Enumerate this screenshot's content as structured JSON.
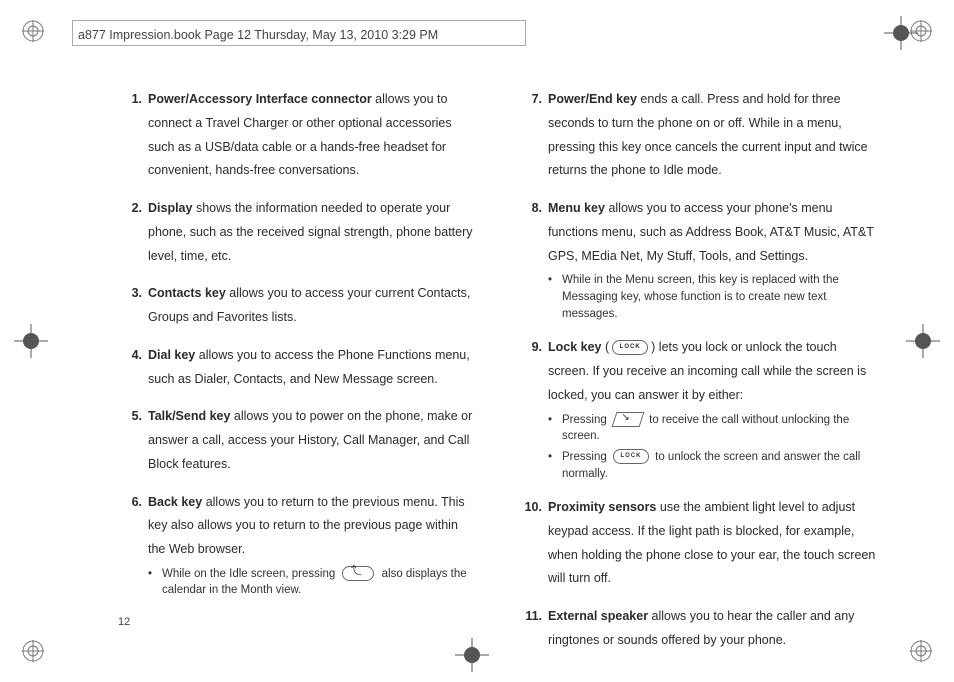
{
  "header": "a877 Impression.book  Page 12  Thursday, May 13, 2010  3:29 PM",
  "page_number": "12",
  "items": [
    {
      "n": "1.",
      "term": "Power/Accessory Interface connector",
      "body": " allows you to connect a Travel Charger or other optional accessories such as a USB/data cable or a hands-free headset for convenient, hands-free conversations."
    },
    {
      "n": "2.",
      "term": "Display",
      "body": " shows the information needed to operate your phone, such as the received signal strength, phone battery level, time, etc."
    },
    {
      "n": "3.",
      "term": "Contacts key",
      "body": " allows you to access your current Contacts, Groups and Favorites lists."
    },
    {
      "n": "4.",
      "term": "Dial key",
      "body": " allows you to access the Phone Functions menu, such as Dialer, Contacts, and New Message screen."
    },
    {
      "n": "5.",
      "term": "Talk/Send key",
      "body": " allows you to power on the phone, make or answer a call, access your History, Call Manager, and Call Block features."
    },
    {
      "n": "6.",
      "term": "Back key",
      "body": " allows you to return to the previous menu. This key also allows you to return to the previous page within the Web browser.",
      "sub": [
        {
          "pre": "While on the Idle screen, pressing ",
          "icon": "back",
          "post": " also displays the calendar in the Month view."
        }
      ]
    },
    {
      "n": "7.",
      "term": "Power/End key",
      "body": " ends a call. Press and hold for three seconds to turn the phone on or off. While in a menu, pressing this key once cancels the current input and twice returns the phone to Idle mode."
    },
    {
      "n": "8.",
      "term": "Menu key",
      "body": " allows you to access your phone's menu functions menu, such as Address Book, AT&T Music, AT&T GPS, MEdia Net, My Stuff, Tools, and Settings.",
      "sub": [
        {
          "pre": "While in the Menu screen, this key is replaced with the Messaging key, whose function is to create new text messages.",
          "icon": "",
          "post": ""
        }
      ]
    },
    {
      "n": "9.",
      "term": "Lock key",
      "body_pre": " (",
      "body_icon": "lock",
      "body_post": ") lets you lock or unlock the touch screen. If you receive an incoming call while the screen is locked, you can answer it by either:",
      "sub": [
        {
          "pre": "Pressing ",
          "icon": "call",
          "post": " to receive the call without unlocking the screen."
        },
        {
          "pre": "Pressing ",
          "icon": "lock",
          "post": " to unlock the screen and answer the call normally."
        }
      ]
    },
    {
      "n": "10.",
      "term": "Proximity sensors",
      "body": " use the ambient light level to adjust keypad access. If the light path is blocked, for example, when holding the phone close to your ear, the touch screen will turn off."
    },
    {
      "n": "11.",
      "term": "External speaker",
      "body": " allows you to hear the caller and any ringtones or sounds offered by your phone."
    }
  ],
  "icons": {
    "lock_label": "LOCK"
  }
}
